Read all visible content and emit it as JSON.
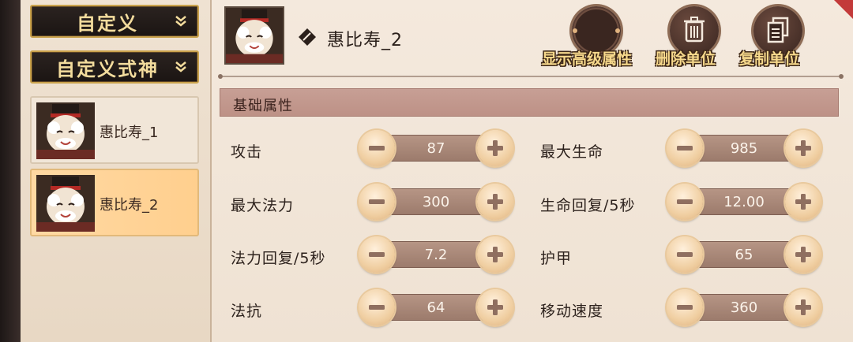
{
  "sidebar": {
    "dropdown_custom": "自定义",
    "dropdown_custom_shikigami": "自定义式神",
    "units": [
      {
        "name": "惠比寿_1",
        "selected": false
      },
      {
        "name": "惠比寿_2",
        "selected": true
      }
    ]
  },
  "header": {
    "unit_name": "惠比寿_2",
    "show_advanced_label": "显示高级属性",
    "delete_label": "删除单位",
    "copy_label": "复制单位"
  },
  "section": {
    "title": "基础属性"
  },
  "stats": [
    {
      "label": "攻击",
      "value": "87"
    },
    {
      "label": "最大生命",
      "value": "985"
    },
    {
      "label": "最大法力",
      "value": "300"
    },
    {
      "label": "生命回复/5秒",
      "value": "12.00"
    },
    {
      "label": "法力回复/5秒",
      "value": "7.2"
    },
    {
      "label": "护甲",
      "value": "65"
    },
    {
      "label": "法抗",
      "value": "64"
    },
    {
      "label": "移动速度",
      "value": "360"
    }
  ],
  "colors": {
    "accent_gold": "#f3dc9d",
    "panel_bg": "#f4e9dd",
    "selected_unit": "#ffd9a3",
    "section_bar": "#c79f95",
    "stepper_track": "#b69585"
  }
}
